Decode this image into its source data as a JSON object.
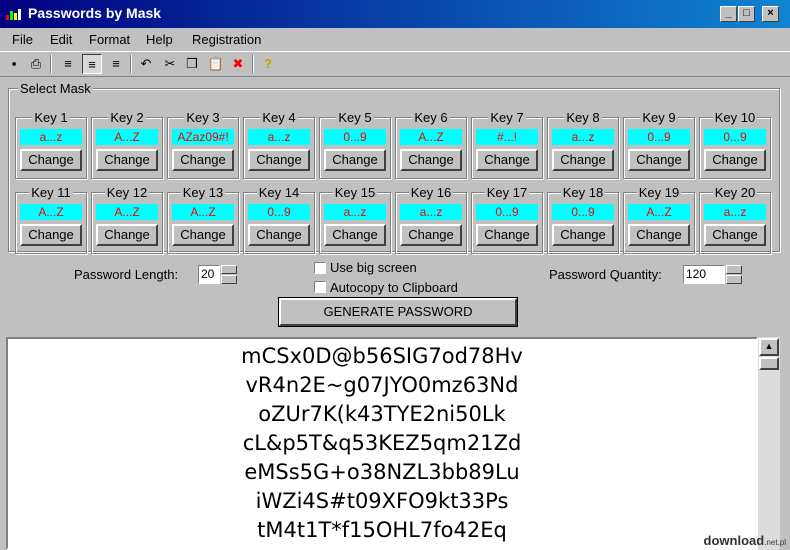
{
  "window": {
    "title": "Passwords by Mask",
    "min": "_",
    "max": "□",
    "close": "×"
  },
  "menu": [
    "File",
    "Edit",
    "Format",
    "Help",
    "Registration"
  ],
  "toolbar": {
    "icons": [
      "save-icon",
      "print-icon",
      "align-left-icon",
      "align-center-icon",
      "align-right-icon",
      "undo-icon",
      "cut-icon",
      "copy-icon",
      "paste-icon",
      "delete-icon",
      "help-icon"
    ],
    "glyphs": [
      "▪",
      "⎙",
      "≡",
      "≡",
      "≡",
      "↶",
      "✂",
      "❐",
      "📋",
      "✖",
      "?"
    ]
  },
  "select_mask": {
    "label": "Select Mask",
    "change_label": "Change",
    "keys": [
      {
        "label": "Key 1",
        "mask": "a...z"
      },
      {
        "label": "Key 2",
        "mask": "A...Z"
      },
      {
        "label": "Key 3",
        "mask": "AZaz09#!"
      },
      {
        "label": "Key 4",
        "mask": "a...z"
      },
      {
        "label": "Key 5",
        "mask": "0...9"
      },
      {
        "label": "Key 6",
        "mask": "A...Z"
      },
      {
        "label": "Key 7",
        "mask": "#...!"
      },
      {
        "label": "Key 8",
        "mask": "a...z"
      },
      {
        "label": "Key 9",
        "mask": "0...9"
      },
      {
        "label": "Key 10",
        "mask": "0...9"
      },
      {
        "label": "Key 11",
        "mask": "A...Z"
      },
      {
        "label": "Key 12",
        "mask": "A...Z"
      },
      {
        "label": "Key 13",
        "mask": "A...Z"
      },
      {
        "label": "Key 14",
        "mask": "0...9"
      },
      {
        "label": "Key 15",
        "mask": "a...z"
      },
      {
        "label": "Key 16",
        "mask": "a...z"
      },
      {
        "label": "Key 17",
        "mask": "0...9"
      },
      {
        "label": "Key 18",
        "mask": "0...9"
      },
      {
        "label": "Key 19",
        "mask": "A...Z"
      },
      {
        "label": "Key 20",
        "mask": "a...z"
      }
    ]
  },
  "options": {
    "length_label": "Password Length:",
    "length_value": "20",
    "big_screen_label": "Use big screen",
    "autocopy_label": "Autocopy to Clipboard",
    "quantity_label": "Password Quantity:",
    "quantity_value": "120",
    "generate_label": "GENERATE PASSWORD"
  },
  "passwords": [
    "mCSx0D@b56SIG7od78Hv",
    "vR4n2E~g07JYO0mz63Nd",
    "oZUr7K(k43TYE2ni50Lk",
    "cL&p5T&q53KEZ5qm21Zd",
    "eMSs5G+o38NZL3bb89Lu",
    "iWZi4S#t09XFO9kt33Ps",
    "tM4t1T*f15OHL7fo42Eq"
  ],
  "watermark": {
    "text": "download",
    "suffix": ".net.pl"
  },
  "colors": {
    "title_start": "#000080",
    "title_end": "#1084d0",
    "mask_bg": "#00ffff",
    "mask_text": "#ff0000"
  }
}
